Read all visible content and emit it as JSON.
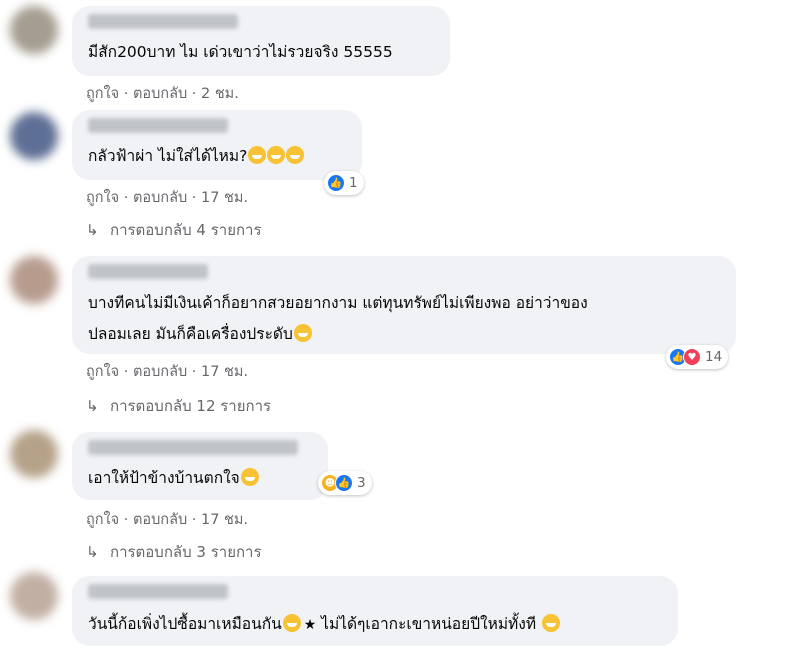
{
  "comments": [
    {
      "text": [
        "มีสัก200บาท ไม เด่วเขาว่าไม่รวยจริง 55555"
      ],
      "like": "ถูกใจ",
      "reply": "ตอบกลับ",
      "time": "2 ชม."
    },
    {
      "text": [
        "กลัวฟ้าผ่า ไม่ใส่ได้ไหม?"
      ],
      "like": "ถูกใจ",
      "reply": "ตอบกลับ",
      "time": "17 ชม.",
      "reaction_count": "1",
      "reactions": [
        "like"
      ],
      "replies": "การตอบกลับ 4 รายการ"
    },
    {
      "text": [
        "บางทีคนไม่มีเงินเค้าก็อยากสวยอยากงาม แต่ทุนทรัพย์ไม่เพียงพอ อย่าว่าของ",
        "ปลอมเลย มันก็คือเครื่องประดับ"
      ],
      "like": "ถูกใจ",
      "reply": "ตอบกลับ",
      "time": "17 ชม.",
      "reaction_count": "14",
      "reactions": [
        "like",
        "love"
      ],
      "replies": "การตอบกลับ 12 รายการ"
    },
    {
      "text": [
        "เอาให้ป้าข้างบ้านตกใจ"
      ],
      "like": "ถูกใจ",
      "reply": "ตอบกลับ",
      "time": "17 ชม.",
      "reaction_count": "3",
      "reactions": [
        "haha",
        "like"
      ],
      "replies": "การตอบกลับ 3 รายการ"
    },
    {
      "text": [
        "วันนี้ก้อเพิ่งไปซื้อมาเหมือนกัน",
        " ไม่ได้ๆเอากะเขาหน่อยปีใหม่ทั้งที "
      ]
    }
  ],
  "separator": " · ",
  "colors": {
    "bubble": "#f0f2f5",
    "meta": "#65676b",
    "like": "#1877f2",
    "love": "#f33e58"
  }
}
